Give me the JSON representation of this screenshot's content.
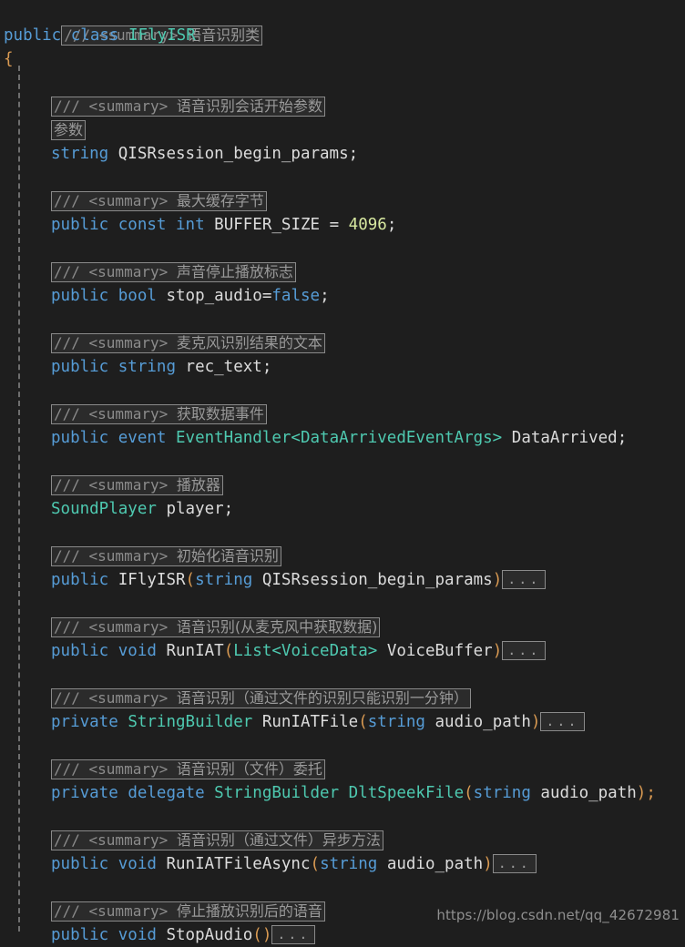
{
  "editor": {
    "language": "csharp",
    "theme": "dark",
    "background_color": "#1e1e1e",
    "colors": {
      "keyword": "#569cd6",
      "type": "#4ec9b0",
      "identifier": "#dcdcdc",
      "number": "#d7e8a0",
      "comment_box_text": "#9a9a9a",
      "comment_box_border": "#8a8a8a",
      "bracket": "#d99a52",
      "indent_guide": "#6e6e6e"
    }
  },
  "watermark": {
    "text": "https://blog.csdn.net/qq_42672981"
  },
  "doc_prefix": "/// ",
  "doc_tag": "<summary>",
  "code": {
    "class_doc": "语音识别类",
    "class_decl": {
      "modifier": "public",
      "keyword": "class",
      "name": "IFlyISR"
    },
    "open_brace": "{",
    "members": [
      {
        "doc": "语音识别会话开始参数",
        "doc_continuation": "参数",
        "signature_parts": [
          {
            "text": "string",
            "kind": "keyword"
          },
          {
            "text": " ",
            "kind": "plain"
          },
          {
            "text": "QISRsession_begin_params",
            "kind": "identifier"
          },
          {
            "text": ";",
            "kind": "plain"
          }
        ],
        "collapsed_body": false
      },
      {
        "doc": "最大缓存字节",
        "signature_parts": [
          {
            "text": "public",
            "kind": "keyword"
          },
          {
            "text": " ",
            "kind": "plain"
          },
          {
            "text": "const",
            "kind": "keyword"
          },
          {
            "text": " ",
            "kind": "plain"
          },
          {
            "text": "int",
            "kind": "keyword"
          },
          {
            "text": " ",
            "kind": "plain"
          },
          {
            "text": "BUFFER_SIZE",
            "kind": "identifier"
          },
          {
            "text": " = ",
            "kind": "plain"
          },
          {
            "text": "4096",
            "kind": "number"
          },
          {
            "text": ";",
            "kind": "plain"
          }
        ],
        "collapsed_body": false
      },
      {
        "doc": "声音停止播放标志",
        "signature_parts": [
          {
            "text": "public",
            "kind": "keyword"
          },
          {
            "text": " ",
            "kind": "plain"
          },
          {
            "text": "bool",
            "kind": "keyword"
          },
          {
            "text": " ",
            "kind": "plain"
          },
          {
            "text": "stop_audio",
            "kind": "identifier"
          },
          {
            "text": "=",
            "kind": "plain"
          },
          {
            "text": "false",
            "kind": "keyword"
          },
          {
            "text": ";",
            "kind": "plain"
          }
        ],
        "collapsed_body": false
      },
      {
        "doc": "麦克风识别结果的文本",
        "signature_parts": [
          {
            "text": "public",
            "kind": "keyword"
          },
          {
            "text": " ",
            "kind": "plain"
          },
          {
            "text": "string",
            "kind": "keyword"
          },
          {
            "text": " ",
            "kind": "plain"
          },
          {
            "text": "rec_text",
            "kind": "identifier"
          },
          {
            "text": ";",
            "kind": "plain"
          }
        ],
        "collapsed_body": false
      },
      {
        "doc": "获取数据事件",
        "signature_parts": [
          {
            "text": "public",
            "kind": "keyword"
          },
          {
            "text": " ",
            "kind": "plain"
          },
          {
            "text": "event",
            "kind": "keyword"
          },
          {
            "text": " ",
            "kind": "plain"
          },
          {
            "text": "EventHandler<DataArrivedEventArgs>",
            "kind": "type"
          },
          {
            "text": " ",
            "kind": "plain"
          },
          {
            "text": "DataArrived",
            "kind": "identifier"
          },
          {
            "text": ";",
            "kind": "plain"
          }
        ],
        "collapsed_body": false
      },
      {
        "doc": "播放器",
        "signature_parts": [
          {
            "text": "SoundPlayer",
            "kind": "type"
          },
          {
            "text": " ",
            "kind": "plain"
          },
          {
            "text": "player",
            "kind": "identifier"
          },
          {
            "text": ";",
            "kind": "plain"
          }
        ],
        "collapsed_body": false
      },
      {
        "doc": "初始化语音识别",
        "signature_parts": [
          {
            "text": "public",
            "kind": "keyword"
          },
          {
            "text": " ",
            "kind": "plain"
          },
          {
            "text": "IFlyISR",
            "kind": "identifier"
          },
          {
            "text": "(",
            "kind": "bracket"
          },
          {
            "text": "string",
            "kind": "keyword"
          },
          {
            "text": " ",
            "kind": "plain"
          },
          {
            "text": "QISRsession_begin_params",
            "kind": "identifier"
          },
          {
            "text": ")",
            "kind": "bracket"
          }
        ],
        "collapsed_body": true
      },
      {
        "doc": "语音识别(从麦克风中获取数据)",
        "signature_parts": [
          {
            "text": "public",
            "kind": "keyword"
          },
          {
            "text": " ",
            "kind": "plain"
          },
          {
            "text": "void",
            "kind": "keyword"
          },
          {
            "text": " ",
            "kind": "plain"
          },
          {
            "text": "RunIAT",
            "kind": "identifier"
          },
          {
            "text": "(",
            "kind": "bracket"
          },
          {
            "text": "List<VoiceData>",
            "kind": "type"
          },
          {
            "text": " ",
            "kind": "plain"
          },
          {
            "text": "VoiceBuffer",
            "kind": "identifier"
          },
          {
            "text": ")",
            "kind": "bracket"
          }
        ],
        "collapsed_body": true
      },
      {
        "doc": "语音识别（通过文件的识别只能识别一分钟）",
        "signature_parts": [
          {
            "text": "private",
            "kind": "keyword"
          },
          {
            "text": " ",
            "kind": "plain"
          },
          {
            "text": "StringBuilder",
            "kind": "type"
          },
          {
            "text": " ",
            "kind": "plain"
          },
          {
            "text": "RunIATFile",
            "kind": "identifier"
          },
          {
            "text": "(",
            "kind": "bracket"
          },
          {
            "text": "string",
            "kind": "keyword"
          },
          {
            "text": " ",
            "kind": "plain"
          },
          {
            "text": "audio_path",
            "kind": "identifier"
          },
          {
            "text": ")",
            "kind": "bracket"
          }
        ],
        "collapsed_body": true
      },
      {
        "doc": "语音识别（文件）委托",
        "signature_parts": [
          {
            "text": "private",
            "kind": "keyword"
          },
          {
            "text": " ",
            "kind": "plain"
          },
          {
            "text": "delegate",
            "kind": "keyword"
          },
          {
            "text": " ",
            "kind": "plain"
          },
          {
            "text": "StringBuilder",
            "kind": "type"
          },
          {
            "text": " ",
            "kind": "plain"
          },
          {
            "text": "DltSpeekFile",
            "kind": "type"
          },
          {
            "text": "(",
            "kind": "bracket"
          },
          {
            "text": "string",
            "kind": "keyword"
          },
          {
            "text": " ",
            "kind": "plain"
          },
          {
            "text": "audio_path",
            "kind": "identifier"
          },
          {
            "text": ");",
            "kind": "bracket"
          }
        ],
        "collapsed_body": false
      },
      {
        "doc": "语音识别（通过文件）异步方法",
        "signature_parts": [
          {
            "text": "public",
            "kind": "keyword"
          },
          {
            "text": " ",
            "kind": "plain"
          },
          {
            "text": "void",
            "kind": "keyword"
          },
          {
            "text": " ",
            "kind": "plain"
          },
          {
            "text": "RunIATFileAsync",
            "kind": "identifier"
          },
          {
            "text": "(",
            "kind": "bracket"
          },
          {
            "text": "string",
            "kind": "keyword"
          },
          {
            "text": " ",
            "kind": "plain"
          },
          {
            "text": "audio_path",
            "kind": "identifier"
          },
          {
            "text": ")",
            "kind": "bracket"
          }
        ],
        "collapsed_body": true
      },
      {
        "doc": "停止播放识别后的语音",
        "signature_parts": [
          {
            "text": "public",
            "kind": "keyword"
          },
          {
            "text": " ",
            "kind": "plain"
          },
          {
            "text": "void",
            "kind": "keyword"
          },
          {
            "text": " ",
            "kind": "plain"
          },
          {
            "text": "StopAudio",
            "kind": "identifier"
          },
          {
            "text": "()",
            "kind": "bracket"
          }
        ],
        "collapsed_body": true
      }
    ],
    "collapsed_marker": "..."
  }
}
